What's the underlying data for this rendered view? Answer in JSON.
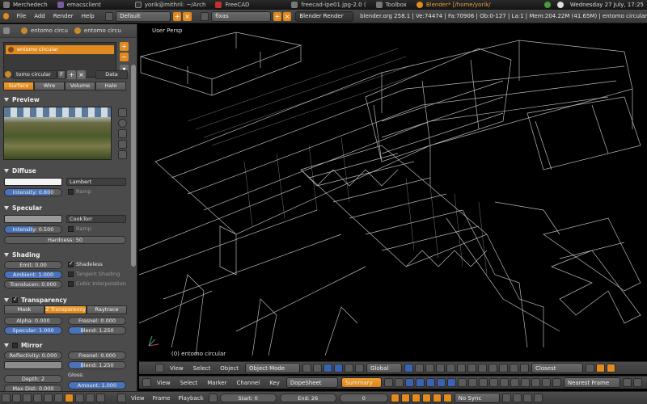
{
  "taskbar": {
    "items": [
      {
        "label": "Merchedech",
        "color": "#6a6a6a"
      },
      {
        "label": "emacsclient",
        "color": "#7a5aa0"
      },
      {
        "label": "yorik@mithril: ~/Arch",
        "color": "#333333"
      },
      {
        "label": "FreeCAD",
        "color": "#c03030"
      },
      {
        "label": "freecad-ipe01.jpg-2.0 (",
        "color": "#777777"
      },
      {
        "label": "Toolbox",
        "color": "#888888"
      },
      {
        "label": "Blender* [/home/yorik/",
        "color": "#e08a20"
      }
    ],
    "clock": "Wednesday 27 July, 17:25"
  },
  "info": {
    "menus": [
      "File",
      "Add",
      "Render",
      "Help"
    ],
    "layout": "Default",
    "scene": "fixas",
    "engine": "Blender Render",
    "stats": "blender.org 258.1 | Ve:74474 | Fa:70906 | Ob:0-127 | La:1 | Mem:204.22M (41.65M) | entomo circular"
  },
  "props": {
    "breadcrumb1": "entomo circu",
    "breadcrumb2": "entomo circu",
    "material_slot": "entomo circular",
    "material_name": "tomo circular",
    "fake_user": "F",
    "data_select": "Data",
    "type_tabs": [
      "Surface",
      "Wire",
      "Volume",
      "Halo"
    ],
    "preview_title": "Preview",
    "diffuse": {
      "title": "Diffuse",
      "shader": "Lambert",
      "intensity": "Intensity: 0.800",
      "ramp": "Ramp",
      "intensity_level": 0.8
    },
    "specular": {
      "title": "Specular",
      "shader": "CookTorr",
      "intensity": "Intensity: 0.500",
      "ramp": "Ramp",
      "hardness": "Hardness: 50",
      "intensity_level": 0.5
    },
    "shading": {
      "title": "Shading",
      "emit": "Emit: 0.00",
      "ambient": "Ambient: 1.000",
      "translucency": "Translucen: 0.000",
      "shadeless": "Shadeless",
      "tangent": "Tangent Shading",
      "cubic": "Cubic Interpolation"
    },
    "transparency": {
      "title": "Transparency",
      "tabs": [
        "Mask",
        "Z Transparency",
        "Raytrace"
      ],
      "alpha": "Alpha: 0.000",
      "specular": "Specular: 1.000",
      "fresnel": "Fresnel: 0.000",
      "blend": "Blend: 1.250"
    },
    "mirror": {
      "title": "Mirror",
      "reflectivity": "Reflectivity: 0.000",
      "fresnel": "Fresnel: 0.000",
      "blend": "Blend: 1.250",
      "depth": "Depth: 2",
      "max_dist": "Max Dist: 0.000",
      "gloss": "Gloss:",
      "amount": "Amount: 1.000"
    }
  },
  "viewport": {
    "label": "User Persp",
    "object_label": "(0) entomo circular",
    "header": {
      "menus": [
        "View",
        "Select",
        "Object"
      ],
      "mode": "Object Mode",
      "orientation": "Global",
      "snap": "Closest"
    }
  },
  "dopesheet": {
    "menus": [
      "View",
      "Select",
      "Marker",
      "Channel",
      "Key"
    ],
    "mode": "DopeSheet",
    "summary": "Summary",
    "snap": "Nearest Frame"
  },
  "timeline": {
    "menus": [
      "View",
      "Frame",
      "Playback"
    ],
    "start": "Start: 0",
    "end": "End: 26",
    "current": "0",
    "sync": "No Sync"
  },
  "colors": {
    "accent": "#e08a20",
    "selection_blue": "#3a62b0",
    "panel": "#4b4b4b"
  }
}
